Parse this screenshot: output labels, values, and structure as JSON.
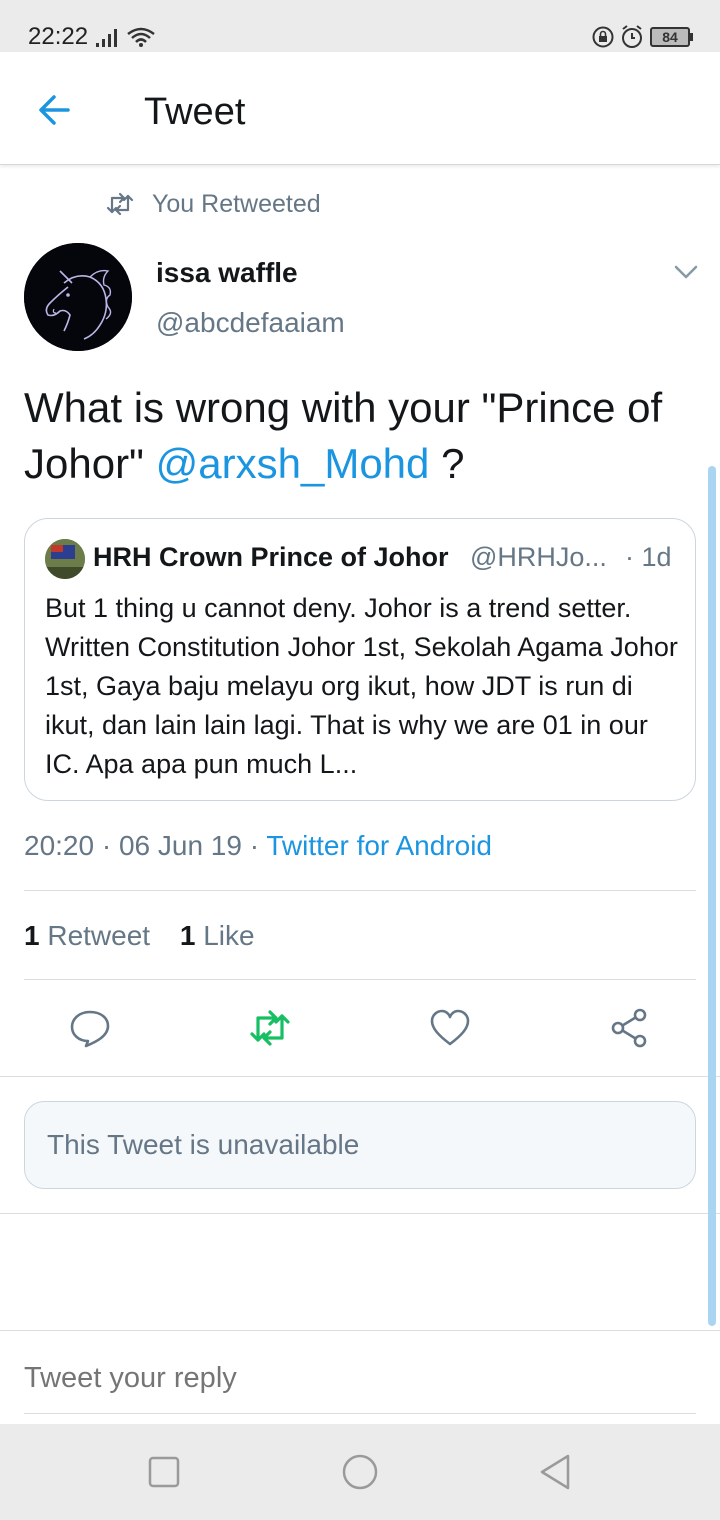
{
  "status_bar": {
    "time": "22:22",
    "battery": "84"
  },
  "app_bar": {
    "back_icon": "arrow-left-icon",
    "title": "Tweet"
  },
  "tweet": {
    "retweet_context": "You Retweeted",
    "author": {
      "display_name": "issa waffle",
      "handle": "@abcdefaaiam"
    },
    "text_before": "What is wrong with your \"Prince of Johor\" ",
    "mention": "@arxsh_Mohd",
    "text_after": " ?",
    "quote": {
      "display_name": "HRH Crown Prince of Johor",
      "handle": "@HRHJo...",
      "time": "· 1d",
      "text": "But 1 thing u cannot deny. Johor is a trend setter. Written Constitution Johor 1st, Sekolah Agama Johor 1st, Gaya baju melayu org ikut, how JDT is run di ikut, dan lain lain lagi. That is why we are 01 in our IC. Apa apa pun much L..."
    },
    "timestamp": "20:20 · 06 Jun 19 · ",
    "client": "Twitter for Android",
    "retweet_count": "1",
    "retweet_label": "Retweet",
    "like_count": "1",
    "like_label": "Like"
  },
  "actions": [
    {
      "name": "reply-icon"
    },
    {
      "name": "retweet-icon",
      "active": true,
      "color": "#17bf63"
    },
    {
      "name": "like-icon"
    },
    {
      "name": "share-icon"
    }
  ],
  "unavailable_notice": "This Tweet is unavailable",
  "reply_box": {
    "placeholder": "Tweet your reply"
  },
  "colors": {
    "accent": "#1b95e0",
    "muted": "#657786",
    "retweet_active": "#17bf63"
  }
}
